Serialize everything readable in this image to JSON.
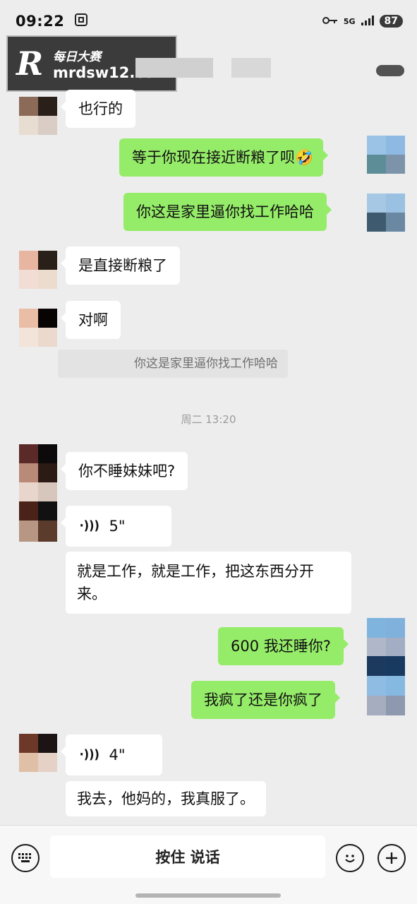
{
  "status_bar": {
    "time": "09:22",
    "network": "5G",
    "battery": "87"
  },
  "header": {
    "watermark_cn": "每日大赛",
    "watermark_url": "mrdsw12.com",
    "watermark_logo": "R"
  },
  "messages": [
    {
      "side": "in",
      "text": "也行的"
    },
    {
      "side": "out",
      "text": "等于你现在接近断粮了呗🤣"
    },
    {
      "side": "out",
      "text": "你这是家里逼你找工作哈哈"
    },
    {
      "side": "in",
      "text": "是直接断粮了"
    },
    {
      "side": "in",
      "text": "对啊"
    },
    {
      "side": "quote",
      "text": "你这是家里逼你找工作哈哈"
    },
    {
      "side": "in",
      "text": "你不睡妹妹吧?"
    },
    {
      "side": "in",
      "text": "5\""
    },
    {
      "side": "in",
      "text": "就是工作，就是工作，把这东西分开来。"
    },
    {
      "side": "out",
      "text": "600 我还睡你?"
    },
    {
      "side": "out",
      "text": "我疯了还是你疯了"
    },
    {
      "side": "in",
      "text": "4\""
    },
    {
      "side": "in",
      "text": "我去，他妈的，我真服了。"
    }
  ],
  "timestamp": "周二 13:20",
  "voice_icon": "voice-wave-icon",
  "bottom_bar": {
    "talk_label": "按住 说话",
    "keyboard_icon": "keyboard-icon",
    "emoji_icon": "emoji-icon",
    "plus_icon": "plus-icon"
  },
  "colors": {
    "background": "#ededed",
    "outgoing_bubble": "#95ec69",
    "incoming_bubble": "#ffffff"
  }
}
